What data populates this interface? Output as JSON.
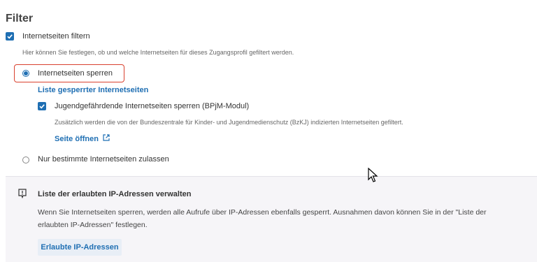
{
  "section": {
    "title": "Filter"
  },
  "filter_websites": {
    "label": "Internetseiten filtern",
    "checked": true,
    "description": "Hier können Sie festlegen, ob und welche Internetseiten für dieses Zugangsprofil gefiltert werden."
  },
  "block_option": {
    "label": "Internetseiten sperren",
    "selected": true,
    "list_link": "Liste gesperrter Internetseiten",
    "bpjm": {
      "label": "Jugendgefährdende Internetseiten sperren (BPjM-Modul)",
      "checked": true,
      "description": "Zusätzlich werden die von der Bundeszentrale für Kinder- und Jugendmedienschutz (BzKJ) indizierten Internetseiten gefiltert.",
      "open_link": "Seite öffnen"
    }
  },
  "allow_option": {
    "label": "Nur bestimmte Internetseiten zulassen",
    "selected": false
  },
  "info": {
    "title": "Liste der erlaubten IP-Adressen verwalten",
    "text": "Wenn Sie Internetseiten sperren, werden alle Aufrufe über IP-Adressen ebenfalls gesperrt. Ausnahmen davon können Sie in der \"Liste der erlaubten IP-Adressen\" festlegen.",
    "button": "Erlaubte IP-Adressen"
  },
  "colors": {
    "accent": "#1f6fb3",
    "highlight": "#d9412e",
    "info_bg": "#f6f5f8"
  },
  "icons": [
    "checkmark-icon",
    "radio-icon",
    "external-link-icon",
    "warning-icon",
    "mouse-cursor-icon"
  ]
}
